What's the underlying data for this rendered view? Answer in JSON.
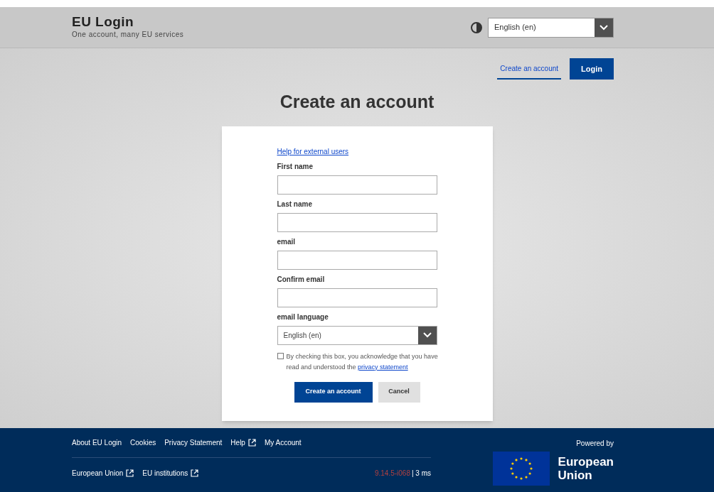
{
  "header": {
    "title": "EU Login",
    "subtitle": "One account, many EU services",
    "language": "English (en)"
  },
  "nav": [
    {
      "label": "Create an account",
      "selected": true
    },
    {
      "label": "Login",
      "selected": false
    }
  ],
  "page_title": "Create an account",
  "form": {
    "help_link": "Help for external users",
    "fields": [
      {
        "label": "First name",
        "kind": "text"
      },
      {
        "label": "Last name",
        "kind": "text"
      },
      {
        "label": "email",
        "kind": "text"
      },
      {
        "label": "Confirm email",
        "kind": "text"
      },
      {
        "label": "email language",
        "kind": "select",
        "value": "English (en)"
      }
    ],
    "consent": {
      "checked": false,
      "text": "By checking this box, you acknowledge that you have read and understood the",
      "link": "privacy statement"
    },
    "buttons": [
      {
        "label": "Create an account",
        "kind": "primary"
      },
      {
        "label": "Cancel",
        "kind": "secondary"
      }
    ]
  },
  "footer": {
    "links": [
      {
        "label": "About EU Login",
        "external": false
      },
      {
        "label": "Cookies",
        "external": false
      },
      {
        "label": "Privacy Statement",
        "external": false
      },
      {
        "label": "Help",
        "external": true
      },
      {
        "label": "My Account",
        "external": false
      }
    ],
    "bottom_links": [
      {
        "label": "European Union",
        "external": true
      },
      {
        "label": "EU institutions",
        "external": true
      }
    ],
    "version": "9.14.5-i068",
    "timing": "| 3 ms",
    "powered_by": "Powered by",
    "logo_text": [
      "European",
      "Union"
    ]
  }
}
